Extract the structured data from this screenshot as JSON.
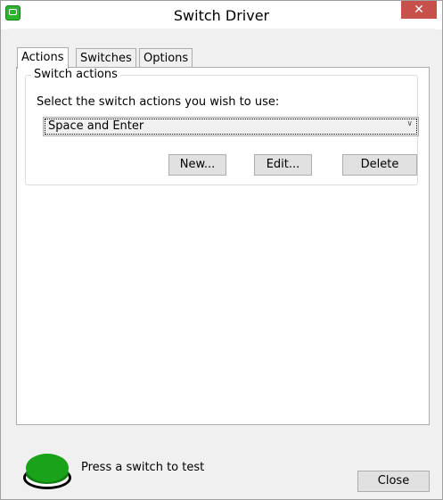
{
  "window": {
    "title": "Switch Driver",
    "close_glyph": "✕"
  },
  "tabs": [
    {
      "label": "Actions",
      "active": true
    },
    {
      "label": "Switches",
      "active": false
    },
    {
      "label": "Options",
      "active": false
    }
  ],
  "actions": {
    "group_title": "Switch actions",
    "prompt": "Select the switch actions you wish to use:",
    "selected_action": "Space and Enter",
    "new_label": "New...",
    "edit_label": "Edit...",
    "delete_label": "Delete"
  },
  "footer": {
    "test_label": "Press a switch to test",
    "close_label": "Close"
  },
  "colors": {
    "switch_green": "#1aa21a",
    "close_red": "#c7504a"
  },
  "icons": {
    "app": "app-icon",
    "switch": "green-switch-icon",
    "dropdown": "chevron-down-icon"
  }
}
